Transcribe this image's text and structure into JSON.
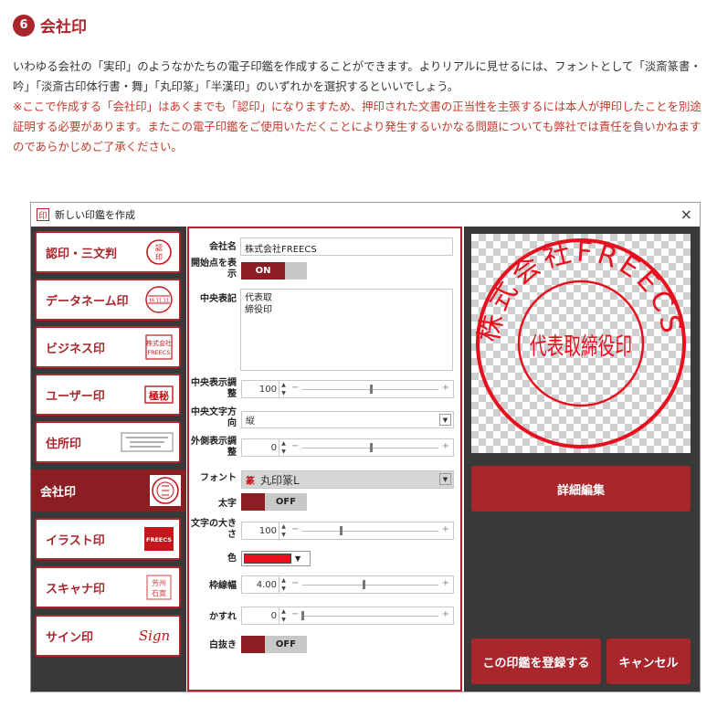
{
  "heading": {
    "number": "6",
    "title": "会社印"
  },
  "description": {
    "line1": "いわゆる会社の「実印」のようなかたちの電子印鑑を作成することができます。よりリアルに見せるには、フォントとして「淡斎篆書・吟」「淡斎古印体行書・舞」「丸印篆」「半漢印」のいずれかを選択するといいでしょう。",
    "notice": "※ここで作成する「会社印」はあくまでも「認印」になりますため、押印された文書の正当性を主張するには本人が押印したことを別途証明する必要があります。またこの電子印鑑をご使用いただくことにより発生するいかなる問題についても弊社では責任を負いかねますのであらかじめご了承ください。"
  },
  "window": {
    "icon_char": "印",
    "title": "新しい印鑑を作成",
    "close": "×"
  },
  "sidebar": {
    "items": [
      {
        "label": "認印・三文判",
        "icon": "round-seal-icon",
        "icon_text": "認印"
      },
      {
        "label": "データネーム印",
        "icon": "date-stamp-icon",
        "icon_text": "16.11.11"
      },
      {
        "label": "ビジネス印",
        "icon": "business-stamp-icon",
        "icon_text": "株式会社 FREECS"
      },
      {
        "label": "ユーザー印",
        "icon": "user-stamp-icon",
        "icon_text": "極秘"
      },
      {
        "label": "住所印",
        "icon": "address-stamp-icon",
        "icon_text": ""
      },
      {
        "label": "会社印",
        "icon": "company-seal-icon",
        "icon_text": ""
      },
      {
        "label": "イラスト印",
        "icon": "illust-stamp-icon",
        "icon_text": "FREECS"
      },
      {
        "label": "スキャナ印",
        "icon": "scan-stamp-icon",
        "icon_text": "芳州 石寛"
      },
      {
        "label": "サイン印",
        "icon": "sign-stamp-icon",
        "icon_text": "Sign"
      }
    ]
  },
  "form": {
    "company_label": "会社名",
    "company_value": "株式会社FREECS",
    "start_label": "開始点を表示",
    "start_value": "ON",
    "center_label": "中央表記",
    "center_value_line1": "代表取",
    "center_value_line2": "締役印",
    "center_adjust_label": "中央表示調整",
    "center_adjust_value": "100",
    "center_dir_label": "中央文字方向",
    "center_dir_value": "縦",
    "outer_adjust_label": "外側表示調整",
    "outer_adjust_value": "0",
    "font_label": "フォント",
    "font_value": "丸印篆L",
    "font_sample": "篆",
    "bold_label": "太字",
    "bold_value": "OFF",
    "size_label": "文字の大きさ",
    "size_value": "100",
    "color_label": "色",
    "color_value": "#e8101e",
    "border_label": "枠線幅",
    "border_value": "4.00",
    "blur_label": "かすれ",
    "blur_value": "0",
    "invert_label": "白抜き",
    "invert_value": "OFF"
  },
  "sliders": {
    "center_adjust": 0.5,
    "outer_adjust": 0.5,
    "size": 0.28,
    "border": 0.45,
    "blur": 0.0
  },
  "preview": {
    "outer_text": "株式会社FREECS",
    "inner_text": "代表取締役印"
  },
  "buttons": {
    "detail_edit": "詳細編集",
    "register": "この印鑑を登録する",
    "cancel": "キャンセル"
  },
  "colors": {
    "accent": "#a8262c",
    "accent_dark": "#8b1e23",
    "panel": "#3a3939",
    "seal_red": "#e8101e"
  }
}
